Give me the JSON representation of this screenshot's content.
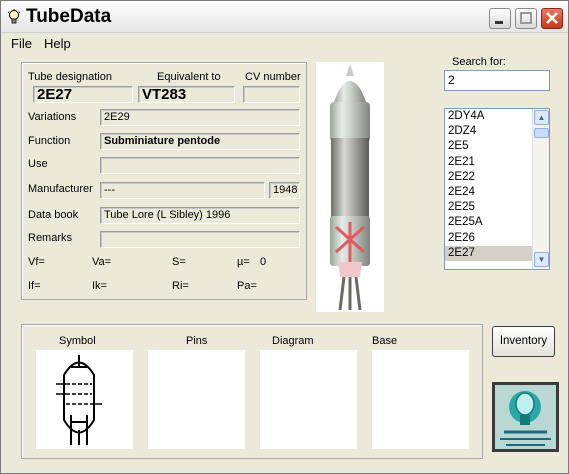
{
  "window": {
    "title": "TubeData"
  },
  "menu": {
    "file": "File",
    "help": "Help"
  },
  "details": {
    "tube_designation_label": "Tube designation",
    "tube_designation": "2E27",
    "equivalent_label": "Equivalent to",
    "equivalent": "VT283",
    "cv_label": "CV number",
    "cv": "",
    "variations_label": "Variations",
    "variations": "2E29",
    "function_label": "Function",
    "function": "Subminiature pentode",
    "use_label": "Use",
    "use": "",
    "manufacturer_label": "Manufacturer",
    "manufacturer": "---",
    "year": "1948",
    "databook_label": "Data book",
    "databook": "Tube Lore (L Sibley) 1996",
    "remarks_label": "Remarks",
    "remarks": ""
  },
  "params": {
    "vf": "Vf=",
    "va": "Va=",
    "s": "S=",
    "mu": "µ=",
    "mu_value": "0",
    "if": "If=",
    "ik": "Ik=",
    "ri": "Ri=",
    "pa": "Pa="
  },
  "search": {
    "label": "Search for:",
    "value": "2",
    "items": [
      "2DY4A",
      "2DZ4",
      "2E5",
      "2E21",
      "2E22",
      "2E24",
      "2E25",
      "2E25A",
      "2E26",
      "2E27"
    ],
    "selected_index": 9
  },
  "bottom": {
    "symbol": "Symbol",
    "pins": "Pins",
    "diagram": "Diagram",
    "base": "Base"
  },
  "inventory_button": "Inventory",
  "colors": {
    "close_button": "#c9351b",
    "selection": "#d4d0c8"
  }
}
